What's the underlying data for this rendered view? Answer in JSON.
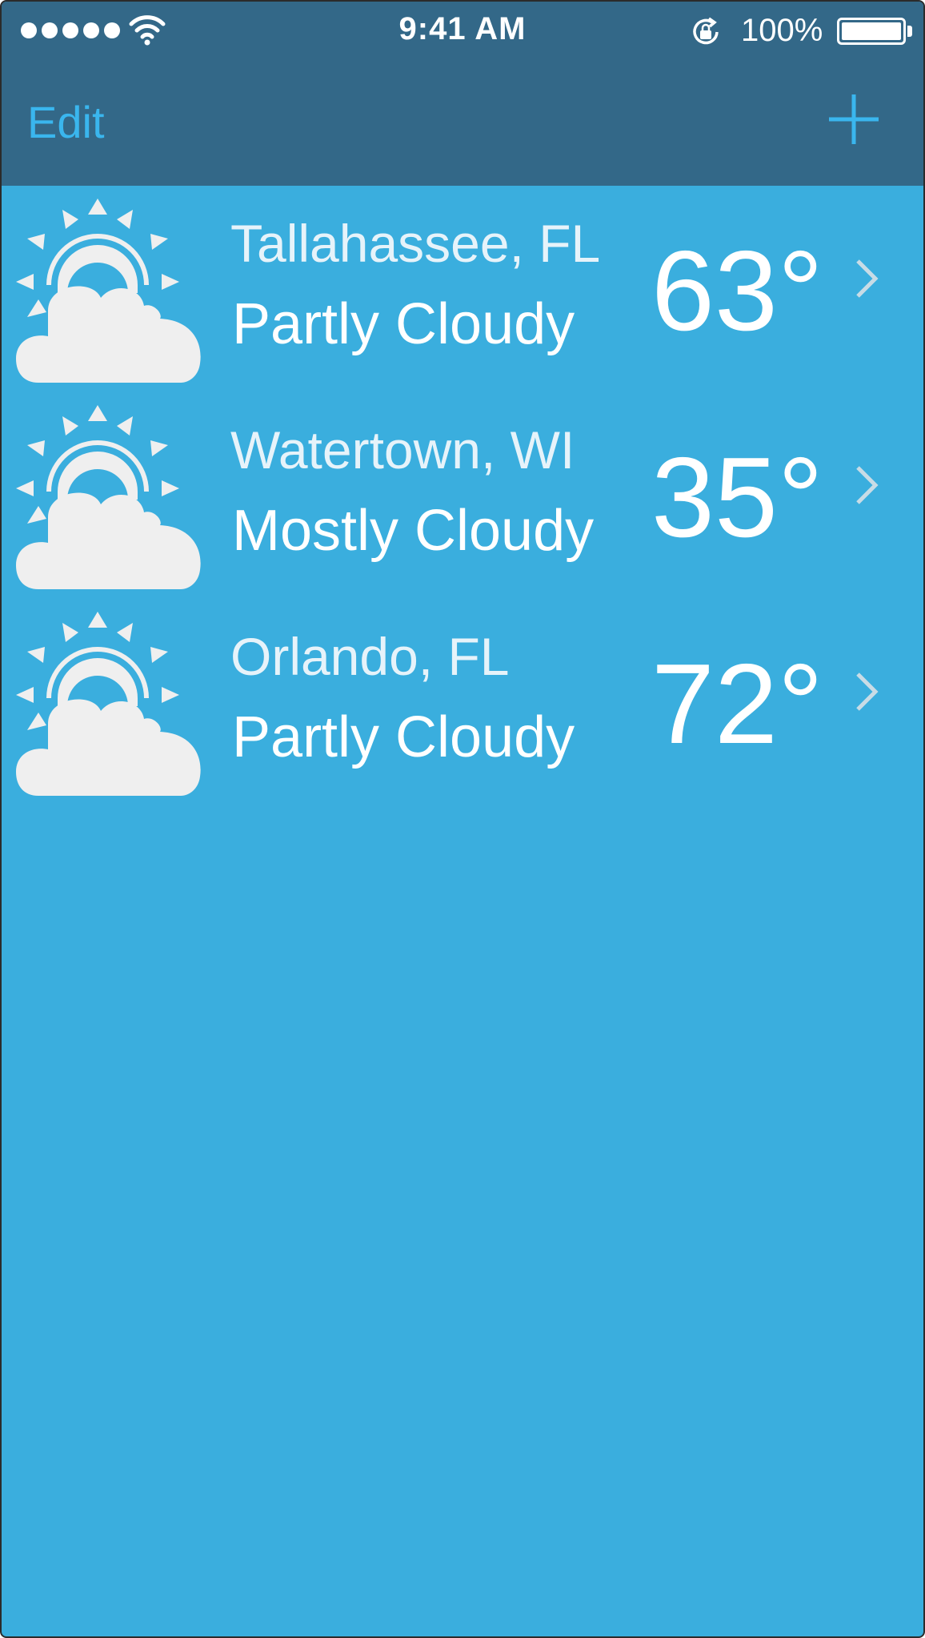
{
  "status_bar": {
    "time": "9:41 AM",
    "battery_percent": "100%",
    "signal_bars": 5,
    "icons": [
      "signal-dots-icon",
      "wifi-icon",
      "orientation-lock-icon",
      "battery-icon"
    ]
  },
  "nav": {
    "edit_label": "Edit",
    "add_icon": "plus-icon"
  },
  "cities": [
    {
      "name": "Tallahassee, FL",
      "condition": "Partly Cloudy",
      "temperature": "63°",
      "icon": "partly-cloudy-icon"
    },
    {
      "name": "Watertown, WI",
      "condition": "Mostly Cloudy",
      "temperature": "35°",
      "icon": "partly-cloudy-icon"
    },
    {
      "name": "Orlando, FL",
      "condition": "Partly Cloudy",
      "temperature": "72°",
      "icon": "partly-cloudy-icon"
    }
  ],
  "colors": {
    "nav_background": "#336888",
    "list_background": "#3aaede",
    "accent": "#3ab6ee",
    "icon_fill": "#efefef"
  }
}
